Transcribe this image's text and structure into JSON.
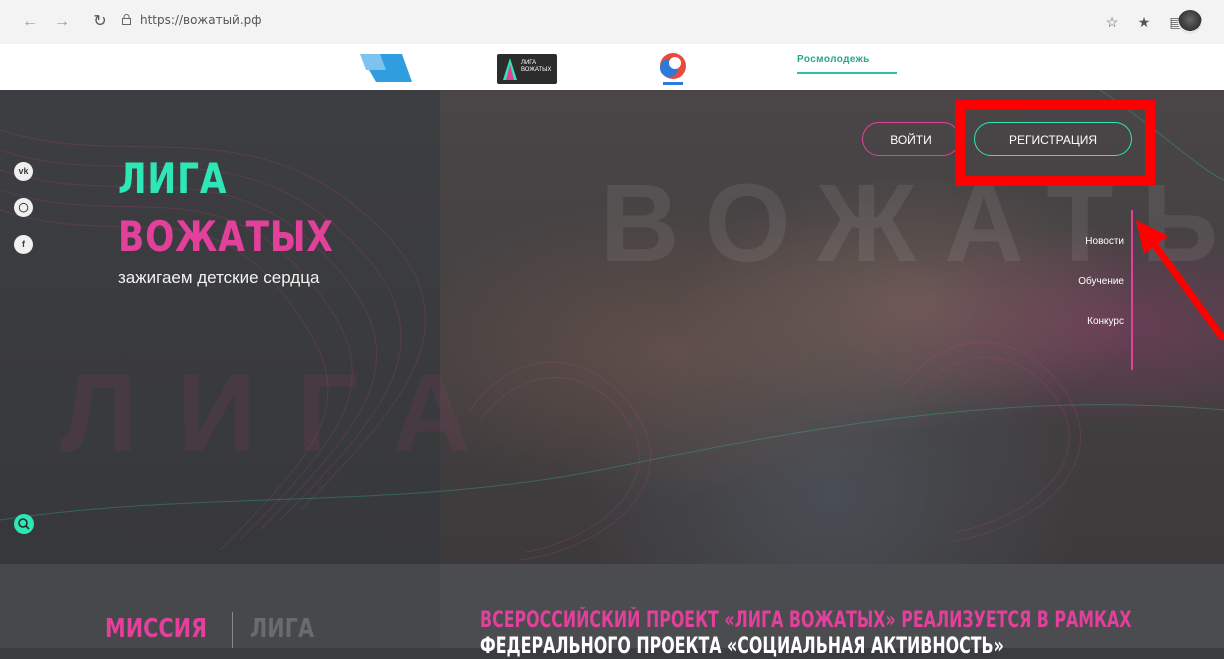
{
  "browser": {
    "url": "https://вожатый.рф",
    "icons": [
      "back-icon",
      "forward-icon",
      "refresh-icon",
      "lock-icon",
      "favorites-star-icon",
      "favorites-bar-icon",
      "collections-icon",
      "profile-avatar"
    ]
  },
  "partners": {
    "logo2_text": "ЛИГА ВОЖАТЫХ",
    "rosmolodezh": "Росмолодежь"
  },
  "hero": {
    "title_line1": "ЛИГА",
    "title_line2": "ВОЖАТЫХ",
    "tagline": "зажигаем детские сердца",
    "bg_letters": "ЛИГА",
    "photo_letters": "ВОЖАТЫХ",
    "social": [
      "vk-icon",
      "instagram-icon",
      "facebook-icon"
    ],
    "login_label": "ВОЙТИ",
    "register_label": "РЕГИСТРАЦИЯ",
    "menu": [
      "Новости",
      "Обучение",
      "Конкурс"
    ]
  },
  "bottom": {
    "mission": "МИССИЯ",
    "liga": "ЛИГА",
    "headline_line1": "ВСЕРОССИЙСКИЙ ПРОЕКТ «ЛИГА ВОЖАТЫХ» РЕАЛИЗУЕТСЯ В РАМКАХ",
    "headline_line2": "ФЕДЕРАЛЬНОГО ПРОЕКТА «СОЦИАЛЬНАЯ АКТИВНОСТЬ»"
  },
  "colors": {
    "accent_teal": "#2ee6b6",
    "accent_pink": "#e2409a",
    "annotation_red": "#ff0000"
  }
}
